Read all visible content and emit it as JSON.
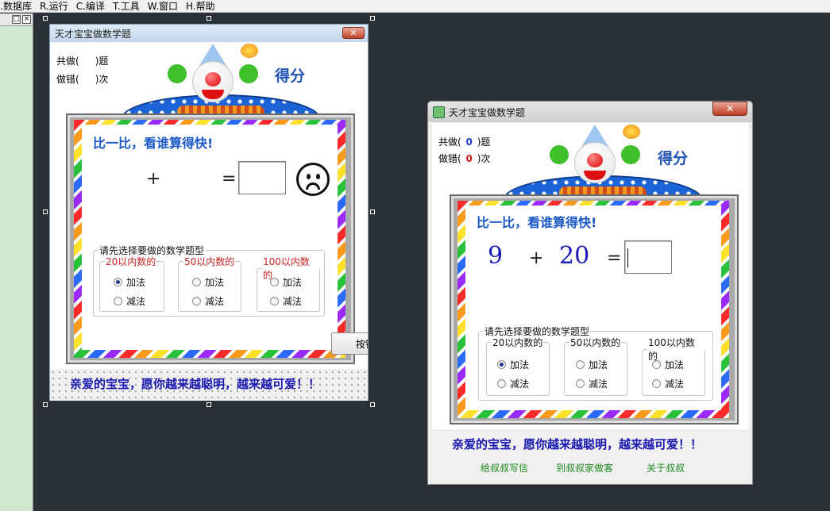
{
  "menu": {
    "items": [
      "B.数据库",
      "R.运行",
      "C.编译",
      "T.工具",
      "W.窗口",
      "H.帮助"
    ]
  },
  "side_panel": {
    "pin_glyph": "□",
    "close_glyph": "×"
  },
  "window_title": "天才宝宝做数学题",
  "close_glyph": "✕",
  "stats": {
    "done_prefix": "共做(",
    "done_suffix": ")题",
    "wrong_prefix": "做错(",
    "wrong_suffix": ")次",
    "done_value": "0",
    "wrong_value": "0",
    "done_color": "#1a3ad0",
    "wrong_color": "#d01a1a"
  },
  "score_label": "得分",
  "headline": "比一比，看谁算得快!",
  "equation": {
    "a": "9",
    "op": "+",
    "b": "20",
    "eq": "="
  },
  "group_title": "请先选择要做的数学题型",
  "groups": [
    {
      "title": "20以内数的",
      "add": "加法",
      "sub": "减法"
    },
    {
      "title": "50以内数的",
      "add": "加法",
      "sub": "减法"
    },
    {
      "title": "100以内数的",
      "add": "加法",
      "sub": "减法"
    }
  ],
  "selected_group": "20以内数的",
  "selected_op": "加法",
  "wish": "亲爱的宝宝，愿你越来越聪明，越来越可爱！！",
  "links": [
    "给叔叔写信",
    "到叔叔家做客",
    "关于叔叔"
  ],
  "design_button_label": "按钮",
  "colors": {
    "accent_blue": "#1958c6",
    "link_green": "#198a19",
    "group_red": "#cc2222"
  }
}
